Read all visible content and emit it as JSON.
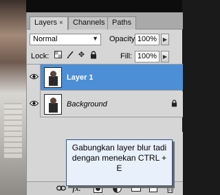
{
  "tabs": [
    {
      "label": "Layers",
      "close": "×",
      "active": true
    },
    {
      "label": "Channels",
      "active": false
    },
    {
      "label": "Paths",
      "active": false
    }
  ],
  "blend_mode": "Normal",
  "opacity": {
    "label": "Opacity:",
    "value": "100%"
  },
  "lock": {
    "label": "Lock:",
    "icons": [
      "transparent-pixels-lock-icon",
      "brush-lock-icon",
      "move-lock-icon",
      "padlock-icon"
    ]
  },
  "fill": {
    "label": "Fill:",
    "value": "100%"
  },
  "layers": [
    {
      "name": "Layer 1",
      "selected": true,
      "visible": true,
      "italic": false,
      "locked": false
    },
    {
      "name": "Background",
      "selected": false,
      "visible": true,
      "italic": true,
      "locked": true
    }
  ],
  "callout": {
    "text": "Gabungkan layer blur tadi dengan menekan CTRL + E"
  },
  "bottom_bar": {
    "icons": [
      "link-icon",
      "fx-icon",
      "mask-icon",
      "adjustment-icon",
      "folder-icon",
      "new-layer-icon",
      "trash-icon"
    ],
    "fx_label": "fx."
  },
  "colors": {
    "selected_row": "#4d8fd6",
    "panel_bg": "#d6d6d6"
  }
}
